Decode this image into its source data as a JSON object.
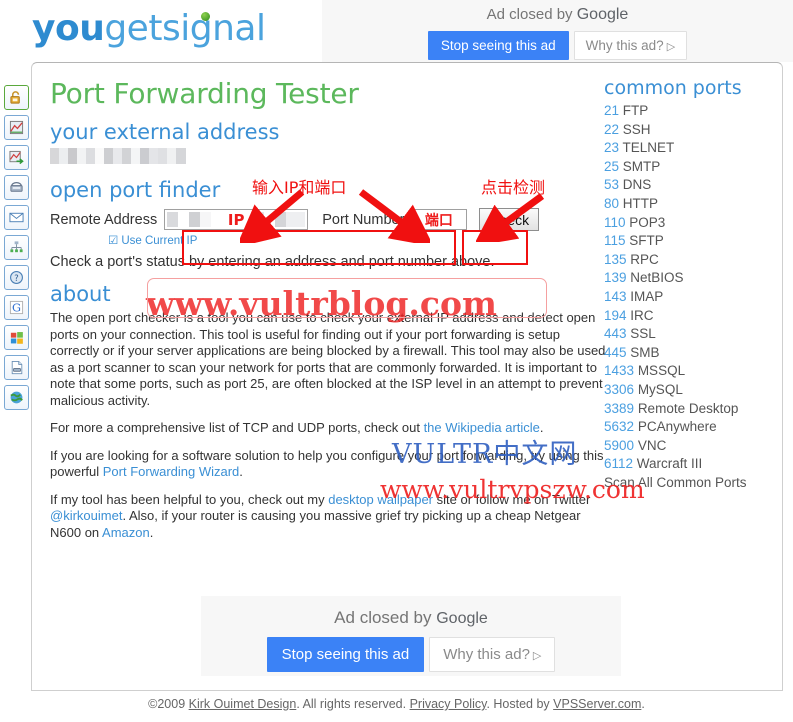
{
  "brand": {
    "you": "you",
    "get": "get",
    "signal": "signal"
  },
  "ads": {
    "top": {
      "closed_text": "Ad closed by ",
      "google": "Google",
      "stop_label": "Stop seeing this ad",
      "why_label": "Why this ad?",
      "why_icon": "play-triangle-icon"
    },
    "bottom": {
      "closed_text": "Ad closed by ",
      "google": "Google",
      "stop_label": "Stop seeing this ad",
      "why_label": "Why this ad?",
      "why_icon": "play-triangle-icon"
    }
  },
  "sidebar": {
    "items": [
      {
        "name": "open-padlock-icon",
        "glyph": "🔓"
      },
      {
        "name": "network-graph-icon",
        "glyph": "📉"
      },
      {
        "name": "network-share-icon",
        "glyph": "📈"
      },
      {
        "name": "phone-icon",
        "glyph": "☎"
      },
      {
        "name": "mail-envelope-icon",
        "glyph": "✉"
      },
      {
        "name": "sitemap-icon",
        "glyph": "⚬"
      },
      {
        "name": "help-question-icon",
        "glyph": "?"
      },
      {
        "name": "google-g-icon",
        "glyph": "G"
      },
      {
        "name": "windows-logo-icon",
        "glyph": "⊞"
      },
      {
        "name": "document-icon",
        "glyph": "📄"
      },
      {
        "name": "globe-icon",
        "glyph": "🌎"
      }
    ]
  },
  "page": {
    "title": "Port Forwarding Tester",
    "external_address_heading": "your external address",
    "external_address_value": "",
    "open_port_finder_heading": "open port finder",
    "remote_address_label": "Remote Address",
    "remote_address_value": "",
    "remote_address_overlay": "IP",
    "port_number_label": "Port Number",
    "port_number_value": "",
    "port_number_overlay": "端口",
    "check_button": "Check",
    "use_current_ip": "Use Current IP",
    "status_line": "Check a port's status by entering an address and port number above.",
    "about_heading": "about",
    "about_paragraphs": [
      "The open port checker is a tool you can use to check your external IP address and detect open ports on your connection. This tool is useful for finding out if your port forwarding is setup correctly or if your server applications are being blocked by a firewall. This tool may also be used as a port scanner to scan your network for ports that are commonly forwarded. It is important to note that some ports, such as port 25, are often blocked at the ISP level in an attempt to prevent malicious activity."
    ],
    "about_p2": {
      "pre": "For more a comprehensive list of TCP and UDP ports, check out ",
      "link": "the Wikipedia article",
      "post": "."
    },
    "about_p3": {
      "pre": "If you are looking for a software solution to help you configure your port forwarding, try using this powerful ",
      "link": "Port Forwarding Wizard",
      "post": "."
    },
    "about_p4": {
      "a": "If my tool has been helpful to you, check out my ",
      "link1": "desktop wallpaper",
      "b": " site or follow me on Twitter ",
      "link2": "@kirkouimet",
      "c": ". Also, if your router is causing you massive grief try picking up a cheap Netgear N600 on ",
      "link3": "Amazon",
      "d": "."
    }
  },
  "annotations": {
    "input_note": "输入IP和端口",
    "check_note": "点击检测"
  },
  "watermarks": {
    "blog": "www.vultrblog.com",
    "vultr_cn": "VULTR中文网",
    "vpszw": "www.vultrvpszw.com"
  },
  "common_ports": {
    "title": "common ports",
    "items": [
      {
        "port": "21",
        "name": "FTP"
      },
      {
        "port": "22",
        "name": "SSH"
      },
      {
        "port": "23",
        "name": "TELNET"
      },
      {
        "port": "25",
        "name": "SMTP"
      },
      {
        "port": "53",
        "name": "DNS"
      },
      {
        "port": "80",
        "name": "HTTP"
      },
      {
        "port": "110",
        "name": "POP3"
      },
      {
        "port": "115",
        "name": "SFTP"
      },
      {
        "port": "135",
        "name": "RPC"
      },
      {
        "port": "139",
        "name": "NetBIOS"
      },
      {
        "port": "143",
        "name": "IMAP"
      },
      {
        "port": "194",
        "name": "IRC"
      },
      {
        "port": "443",
        "name": "SSL"
      },
      {
        "port": "445",
        "name": "SMB"
      },
      {
        "port": "1433",
        "name": "MSSQL"
      },
      {
        "port": "3306",
        "name": "MySQL"
      },
      {
        "port": "3389",
        "name": "Remote Desktop"
      },
      {
        "port": "5632",
        "name": "PCAnywhere"
      },
      {
        "port": "5900",
        "name": "VNC"
      },
      {
        "port": "6112",
        "name": "Warcraft III"
      }
    ],
    "scan_all": "Scan All Common Ports"
  },
  "footer": {
    "copyright": "©2009 ",
    "design_link": "Kirk Ouimet Design",
    "rights": ". All rights reserved. ",
    "privacy_link": "Privacy Policy",
    "hosted": ". Hosted by ",
    "host_link": "VPSServer.com",
    "end": "."
  },
  "colors": {
    "brand_blue": "#2e8bd0",
    "heading_blue": "#3a8fd4",
    "title_green": "#5cb85c",
    "annotation_red": "#f01010",
    "ad_button_blue": "#3b82f6"
  }
}
